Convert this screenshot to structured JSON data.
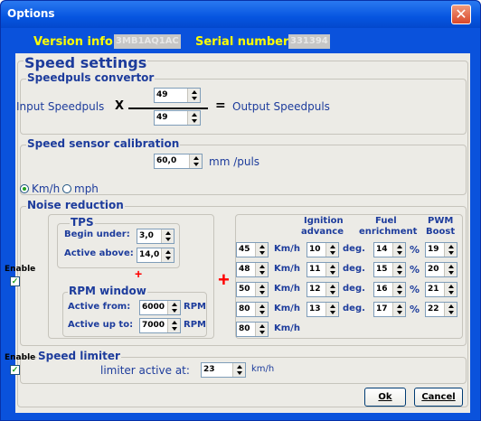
{
  "window": {
    "title": "Options"
  },
  "version": {
    "label": "Version info:",
    "value": "3MB1AQ1AC",
    "serial_label": "Serial number:",
    "serial_value": "331394"
  },
  "speed": {
    "title": "Speed settings",
    "convertor": {
      "title": "Speedpuls convertor",
      "input_label": "Input Speedpuls",
      "x": "X",
      "num": "49",
      "den": "49",
      "equals": "=",
      "output_label": "Output Speedpuls"
    },
    "calibration": {
      "title": "Speed sensor calibration",
      "value": "60,0",
      "unit": "mm /puls",
      "kmh": "Km/h",
      "mph": "mph",
      "selected_unit": "Km/h"
    }
  },
  "noise": {
    "title": "Noise reduction",
    "enable_label": "Enable",
    "enable_checked": true,
    "tps": {
      "title": "TPS",
      "begin_label": "Begin under:",
      "begin_value": "3,0",
      "active_label": "Active above:",
      "active_value": "14,0"
    },
    "rpm": {
      "title": "RPM window",
      "from_label": "Active from:",
      "from_value": "6000",
      "from_unit": "RPM",
      "to_label": "Active up to:",
      "to_value": "7000",
      "to_unit": "RPM"
    },
    "plus1": "+",
    "plus2": "+",
    "headers": {
      "ign_a": "Ignition",
      "ign_b": "advance",
      "fuel_a": "Fuel",
      "fuel_b": "enrichment",
      "pwm_a": "PWM",
      "pwm_b": "Boost"
    },
    "rows": [
      {
        "speed": "45",
        "unit": "Km/h",
        "ign": "10",
        "deg": "deg.",
        "fuel": "14",
        "pct": "%",
        "pwm": "19"
      },
      {
        "speed": "48",
        "unit": "Km/h",
        "ign": "11",
        "deg": "deg.",
        "fuel": "15",
        "pct": "%",
        "pwm": "20"
      },
      {
        "speed": "50",
        "unit": "Km/h",
        "ign": "12",
        "deg": "deg.",
        "fuel": "16",
        "pct": "%",
        "pwm": "21"
      },
      {
        "speed": "80",
        "unit": "Km/h",
        "ign": "13",
        "deg": "deg.",
        "fuel": "17",
        "pct": "%",
        "pwm": "22"
      },
      {
        "speed": "80",
        "unit": "Km/h"
      }
    ]
  },
  "limiter": {
    "enable_label": "Enable",
    "enable_checked": true,
    "title": "Speed limiter",
    "label": "limiter active at:",
    "value": "23",
    "unit": "km/h"
  },
  "buttons": {
    "ok": "Ok",
    "cancel": "Cancel"
  }
}
